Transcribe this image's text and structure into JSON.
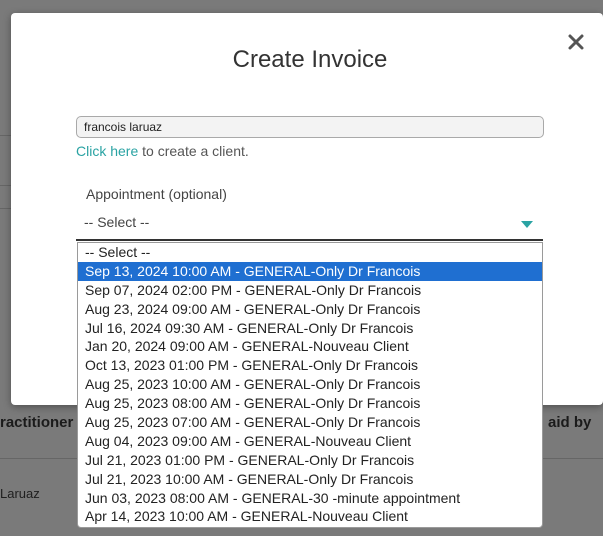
{
  "background": {
    "table_headers": {
      "practitioner": "ractitioner",
      "paid_by": "aid by"
    },
    "row_client": "Laruaz"
  },
  "modal": {
    "title": "Create Invoice",
    "client_input_value": "francois laruaz",
    "create_client_link": "Click here",
    "create_client_text": " to create a client.",
    "appointment_label": "Appointment (optional)",
    "appointment_selected": "-- Select --"
  },
  "dropdown": {
    "options": [
      "-- Select --",
      "Sep 13, 2024 10:00 AM - GENERAL-Only Dr Francois",
      "Sep 07, 2024 02:00 PM - GENERAL-Only Dr Francois",
      "Aug 23, 2024 09:00 AM - GENERAL-Only Dr Francois",
      "Jul 16, 2024 09:30 AM - GENERAL-Only Dr Francois",
      "Jan 20, 2024 09:00 AM - GENERAL-Nouveau Client",
      "Oct 13, 2023 01:00 PM - GENERAL-Only Dr Francois",
      "Aug 25, 2023 10:00 AM - GENERAL-Only Dr Francois",
      "Aug 25, 2023 08:00 AM - GENERAL-Only Dr Francois",
      "Aug 25, 2023 07:00 AM - GENERAL-Only Dr Francois",
      "Aug 04, 2023 09:00 AM - GENERAL-Nouveau Client",
      "Jul 21, 2023 01:00 PM - GENERAL-Only Dr Francois",
      "Jul 21, 2023 10:00 AM - GENERAL-Only Dr Francois",
      "Jun 03, 2023 08:00 AM - GENERAL-30 -minute appointment",
      "Apr 14, 2023 10:00 AM - GENERAL-Nouveau Client"
    ],
    "highlighted_option": "Sep 13, 2024 10:00 AM - GENERAL-Only Dr Francois"
  },
  "colors": {
    "accent": "#2aa3a3",
    "highlight": "#1f6fd1"
  },
  "icons": {
    "close": "close-icon",
    "caret": "caret-down-icon"
  }
}
